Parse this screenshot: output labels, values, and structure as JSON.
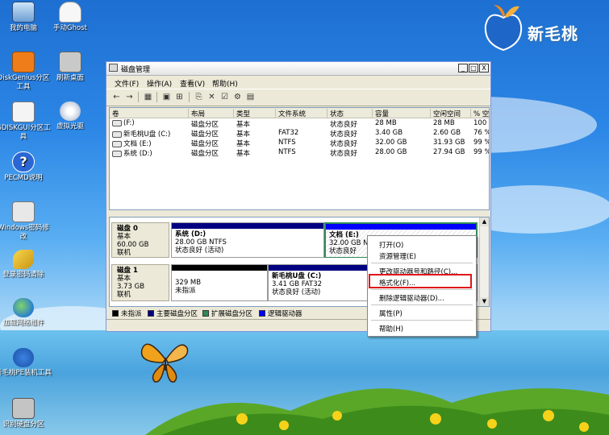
{
  "desktop": {
    "icons": [
      {
        "label": "我的电脑",
        "icon": "computer-icon"
      },
      {
        "label": "手动Ghost",
        "icon": "ghost-icon"
      },
      {
        "label": "DiskGenius分区工具",
        "icon": "diskgenius-icon"
      },
      {
        "label": "刷新桌面",
        "icon": "refresh-icon"
      },
      {
        "label": "GDISKGUI分区工具",
        "icon": "gdisk-icon"
      },
      {
        "label": "虚拟光驱",
        "icon": "virtual-drive-icon"
      },
      {
        "label": "PECMD说明",
        "icon": "help-icon"
      },
      {
        "label": "Windows密码修改",
        "icon": "password-icon"
      },
      {
        "label": "登录密码清除",
        "icon": "key-icon"
      },
      {
        "label": "加载网络组件",
        "icon": "network-icon"
      },
      {
        "label": "新毛桃PE装机工具",
        "icon": "installer-icon"
      },
      {
        "label": "识别硬盘分区",
        "icon": "disk-scan-icon"
      }
    ],
    "logo_text": "新毛桃"
  },
  "window": {
    "title": "磁盘管理",
    "controls": {
      "minimize": "_",
      "maximize": "□",
      "close": "X"
    },
    "menu": [
      "文件(F)",
      "操作(A)",
      "查看(V)",
      "帮助(H)"
    ],
    "toolbar_icons": [
      "back-icon",
      "forward-icon",
      "view-icon",
      "properties-icon",
      "help-icon",
      "refresh-icon",
      "delete-icon",
      "export-icon",
      "settings-icon",
      "format-icon"
    ]
  },
  "volume_list": {
    "columns": [
      "卷",
      "布局",
      "类型",
      "文件系统",
      "状态",
      "容量",
      "空闲空间",
      "% 空"
    ],
    "rows": [
      [
        "(F:)",
        "磁盘分区",
        "基本",
        "",
        "状态良好",
        "28 MB",
        "28 MB",
        "100 %"
      ],
      [
        "新毛桃U盘 (C:)",
        "磁盘分区",
        "基本",
        "FAT32",
        "状态良好",
        "3.40 GB",
        "2.60 GB",
        "76 %"
      ],
      [
        "文档 (E:)",
        "磁盘分区",
        "基本",
        "NTFS",
        "状态良好",
        "32.00 GB",
        "31.93 GB",
        "99 %"
      ],
      [
        "系统 (D:)",
        "磁盘分区",
        "基本",
        "NTFS",
        "状态良好",
        "28.00 GB",
        "27.94 GB",
        "99 %"
      ]
    ]
  },
  "disk_map": {
    "disk0": {
      "name": "磁盘 0",
      "type": "基本",
      "size": "60.00 GB",
      "status": "联机",
      "partitions": [
        {
          "name": "系统 (D:)",
          "size": "28.00 GB NTFS",
          "status": "状态良好 (活动)"
        },
        {
          "name": "文档 (E:)",
          "size": "32.00 GB NTFS",
          "status": "状态良好"
        }
      ]
    },
    "disk1": {
      "name": "磁盘 1",
      "type": "基本",
      "size": "3.73 GB",
      "status": "联机",
      "partitions": [
        {
          "name": "",
          "size": "329 MB",
          "status": "未指派"
        },
        {
          "name": "新毛桃U盘 (C:)",
          "size": "3.41 GB FAT32",
          "status": "状态良好 (活动)"
        }
      ]
    }
  },
  "legend": [
    "未指派",
    "主要磁盘分区",
    "扩展磁盘分区",
    "逻辑驱动器"
  ],
  "legend_colors": [
    "#000000",
    "#000080",
    "#2e8b57",
    "#0000ff"
  ],
  "context_menu": {
    "items": [
      "打开(O)",
      "资源管理(E)",
      "更改驱动器号和路径(C)...",
      "格式化(F)...",
      "删除逻辑驱动器(D)...",
      "属性(P)",
      "帮助(H)"
    ],
    "highlighted": "格式化(F)..."
  },
  "colors": {
    "highlight_box": "#e0151a",
    "primary_partition": "#000080",
    "selected_border": "#2e8b57"
  }
}
